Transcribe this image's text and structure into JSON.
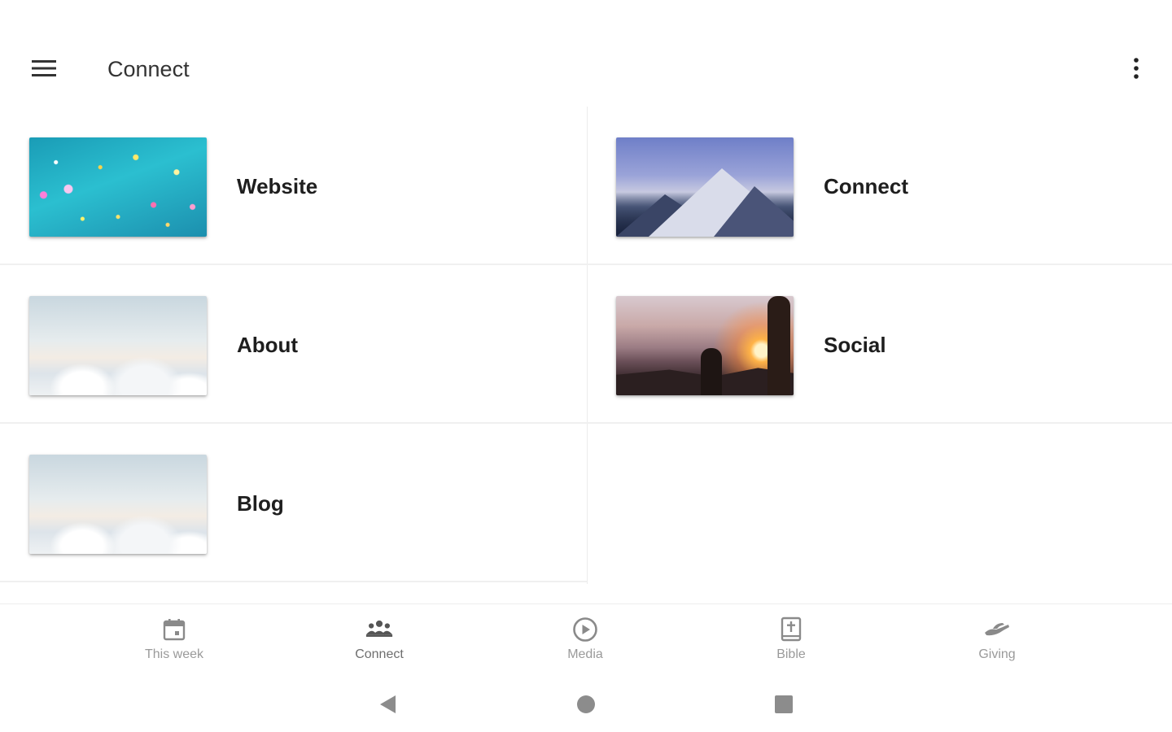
{
  "app_bar": {
    "title": "Connect",
    "menu_icon": "hamburger-menu-icon",
    "overflow_icon": "more-vertical-icon"
  },
  "cards": [
    {
      "label": "Website",
      "image": "confetti-teal-image"
    },
    {
      "label": "Connect",
      "image": "snowy-mountain-image"
    },
    {
      "label": "About",
      "image": "clouds-image"
    },
    {
      "label": "Social",
      "image": "sunset-hikers-image"
    },
    {
      "label": "Blog",
      "image": "clouds-image"
    }
  ],
  "bottom_nav": {
    "items": [
      {
        "label": "This week",
        "icon": "calendar-icon",
        "active": false
      },
      {
        "label": "Connect",
        "icon": "people-group-icon",
        "active": true
      },
      {
        "label": "Media",
        "icon": "play-circle-icon",
        "active": false
      },
      {
        "label": "Bible",
        "icon": "bible-icon",
        "active": false
      },
      {
        "label": "Giving",
        "icon": "giving-hand-icon",
        "active": false
      }
    ]
  },
  "system_nav": {
    "back_icon": "back-triangle-icon",
    "home_icon": "home-circle-icon",
    "recents_icon": "recents-square-icon"
  },
  "colors": {
    "background": "#ffffff",
    "text_primary": "#1e1e1e",
    "nav_inactive": "#9a9a9a",
    "nav_active": "#6e6e6e",
    "divider": "#ececec"
  }
}
